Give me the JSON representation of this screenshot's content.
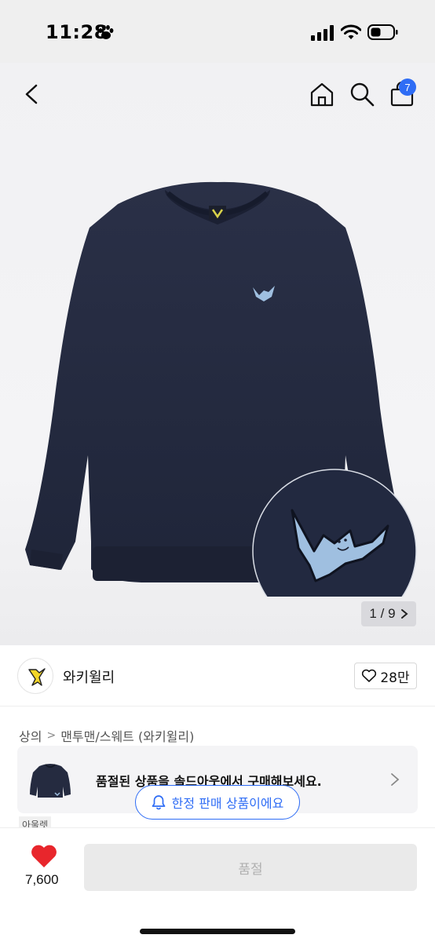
{
  "status": {
    "time": "11:28"
  },
  "nav": {
    "cart_count": "7",
    "icons": [
      "back-icon",
      "home-icon",
      "search-icon",
      "shopping-bag-icon"
    ]
  },
  "gallery": {
    "current": "1",
    "separator": "/",
    "total": "9"
  },
  "brand": {
    "name": "와키윌리",
    "likes": "28만"
  },
  "breadcrumb": {
    "category": "상의",
    "separator": ">",
    "subcategory": "맨투맨/스웨트 (와키윌리)"
  },
  "soldout_banner": {
    "text": "품절된 상품을 솔드아웃에서 구매해보세요."
  },
  "limited": {
    "text": "한정 판매 상품이에요"
  },
  "outlet_tag": "아울렛",
  "bottom": {
    "like_count": "7,600",
    "buy_label": "품절"
  },
  "colors": {
    "accent": "#2f6df5",
    "heart": "#e8262c",
    "sweatshirt": "#252b40",
    "patch": "#9fbfe0"
  }
}
